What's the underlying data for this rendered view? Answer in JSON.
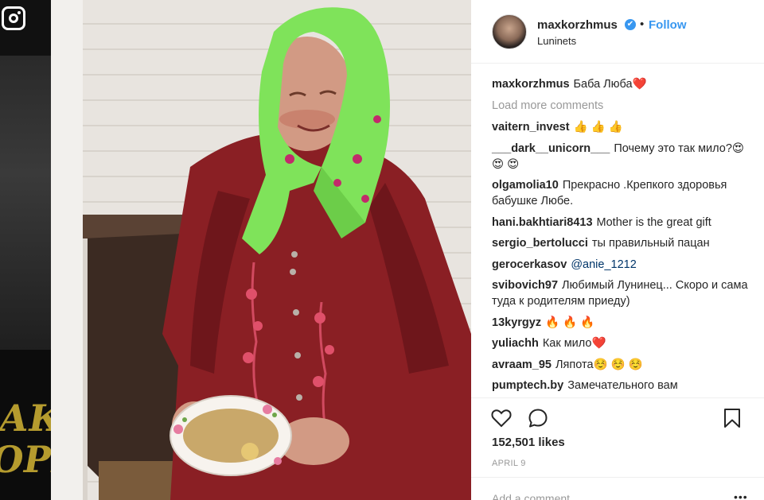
{
  "post": {
    "username": "maxkorzhmus",
    "verified_badge": "✔",
    "separator": "•",
    "follow_label": "Follow",
    "location": "Luninets",
    "caption_user": "maxkorzhmus",
    "caption_text": "Баба Люба❤️",
    "load_more": "Load more comments",
    "likes": "152,501 likes",
    "date": "APRIL 9",
    "add_comment_placeholder": "Add a comment...",
    "more_options": "•••"
  },
  "comments": [
    {
      "user": "vaitern_invest",
      "text": "👍 👍 👍"
    },
    {
      "user": "___dark__unicorn___",
      "text": "Почему это так мило?😍 😍 😍"
    },
    {
      "user": "olgamolia10",
      "text": "Прекрасно .Крепкого здоровья бабушке Любе."
    },
    {
      "user": "hani.bakhtiari8413",
      "text": "Mother is the great gift"
    },
    {
      "user": "sergio_bertolucci",
      "text": "ты правильный пацан"
    },
    {
      "user": "gerocerkasov",
      "text": "@anie_1212"
    },
    {
      "user": "svibovich97",
      "text": "Любимый Лунинец... Скоро и сама туда к родителям приеду)"
    },
    {
      "user": "13kyrgyz",
      "text": "🔥 🔥 🔥"
    },
    {
      "user": "yuliachh",
      "text": "Как мило❤️"
    },
    {
      "user": "avraam_95",
      "text": "Ляпота☺️ ☺️ ☺️"
    },
    {
      "user": "pumptech.by",
      "text": "Замечательного вам"
    }
  ],
  "icons": {
    "like": "heart-icon",
    "comment": "speech-bubble-icon",
    "save": "bookmark-icon",
    "brand": "instagram-icon"
  },
  "colors": {
    "link_blue": "#3897f0",
    "text": "#262626",
    "muted": "#999999",
    "headscarf_green": "#7fe35a",
    "dress_red": "#8a1f24"
  },
  "background_text": "АКО ОРИ"
}
